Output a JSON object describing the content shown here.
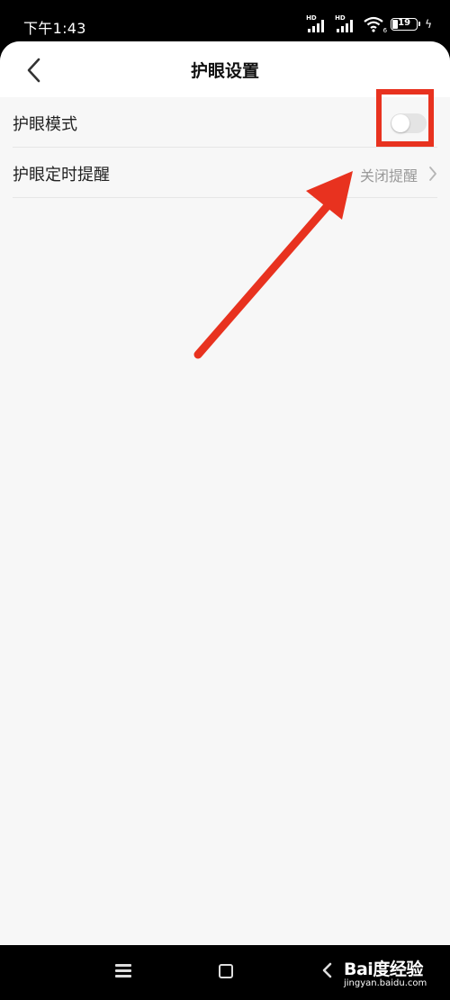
{
  "status_bar": {
    "time": "下午1:43",
    "signal_1_badge": "HD",
    "signal_2_badge": "HD",
    "wifi_badge": "6",
    "battery_level": "19"
  },
  "header": {
    "title": "护眼设置",
    "back_icon": "chevron-left-icon"
  },
  "settings": {
    "eye_mode": {
      "label": "护眼模式",
      "enabled": false
    },
    "reminder": {
      "label": "护眼定时提醒",
      "value": "关闭提醒"
    }
  },
  "annotation": {
    "color": "#e8321f"
  },
  "nav_bar": {
    "icons": [
      "menu-icon",
      "home-icon",
      "back-icon"
    ]
  },
  "watermark": {
    "brand": "Bai度经验",
    "url": "jingyan.baidu.com"
  }
}
